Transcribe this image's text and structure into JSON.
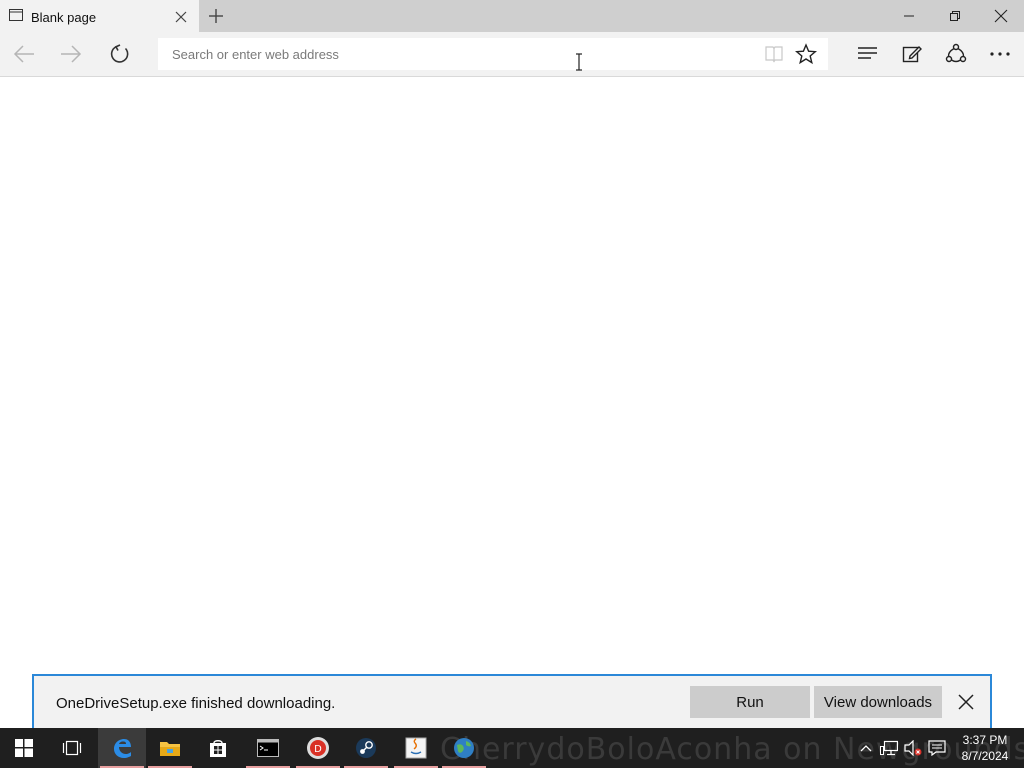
{
  "browser": {
    "tab": {
      "title": "Blank page"
    },
    "address_bar": {
      "placeholder": "Search or enter web address",
      "value": ""
    }
  },
  "download_bar": {
    "message": "OneDriveSetup.exe finished downloading.",
    "run_label": "Run",
    "view_downloads_label": "View downloads"
  },
  "taskbar": {
    "watermark": "CherrydoBoloAconha on Newgrounds",
    "clock": {
      "time": "3:37 PM",
      "date": "8/7/2024"
    }
  },
  "colors": {
    "accent": "#2b88d8",
    "taskbar": "#1f1f1f",
    "chrome": "#f2f2f2"
  }
}
